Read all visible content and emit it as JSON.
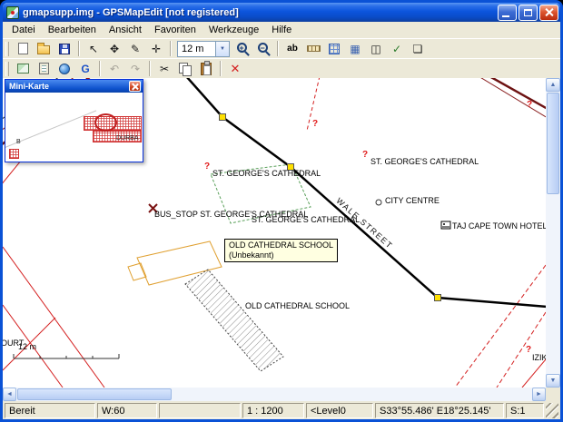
{
  "window": {
    "title": "gmapsupp.img - GPSMapEdit [not registered]"
  },
  "menu": {
    "items": [
      "Datei",
      "Bearbeiten",
      "Ansicht",
      "Favoriten",
      "Werkzeuge",
      "Hilfe"
    ]
  },
  "toolbar": {
    "scale_combo_value": "12 m",
    "label_tool": "ab"
  },
  "icons": {
    "select_tool": "↖",
    "pan_tool": "✥",
    "edit_nodes_tool": "✎",
    "add_object_tool": "✛",
    "zoom_in": "+",
    "zoom_out": "−",
    "combo_arrow": "▼",
    "mesh_toggle": "▦",
    "split_view": "◫",
    "verify_map": "✓",
    "layers": "❏",
    "google_earth": "G",
    "undo": "↶",
    "redo": "↷",
    "cut": "✂",
    "delete": "✕",
    "scroll_up": "▲",
    "scroll_down": "▼",
    "scroll_left": "◄",
    "scroll_right": "►"
  },
  "map": {
    "question_mark": "?",
    "labels": {
      "cathedral": "ST. GEORGE'S CATHEDRAL",
      "bus_stop": "BUS_STOP ST. GEORGE'S CATHEDRAL",
      "city_centre": "CITY CENTRE",
      "hotel": "TAJ CAPE TOWN HOTEL",
      "school": "OLD CATHEDRAL SCHOOL",
      "street": "WALE STREET",
      "izik": "IZIK",
      "court": "OURT",
      "scale": "12 m"
    },
    "tooltip": {
      "line1": "OLD CATHEDRAL SCHOOL",
      "line2": "(Unbekannt)"
    }
  },
  "minimap": {
    "title": "Mini-Karte",
    "label_durban": "DURBA",
    "label_b": "B"
  },
  "statusbar": {
    "ready": "Bereit",
    "width": "W:60",
    "scale": "1 : 1200",
    "level": "<Level0",
    "coords": "S33°55.486' E18°25.145'",
    "selection": "S:1"
  },
  "colors": {
    "road": "#000000",
    "street_red": "#d42020",
    "major_road": "#6d1313",
    "node_yellow": "#ffe000",
    "tooltip_bg": "#ffffe1",
    "titlebar_blue": "#0c55dd",
    "close_red": "#dd5630"
  }
}
